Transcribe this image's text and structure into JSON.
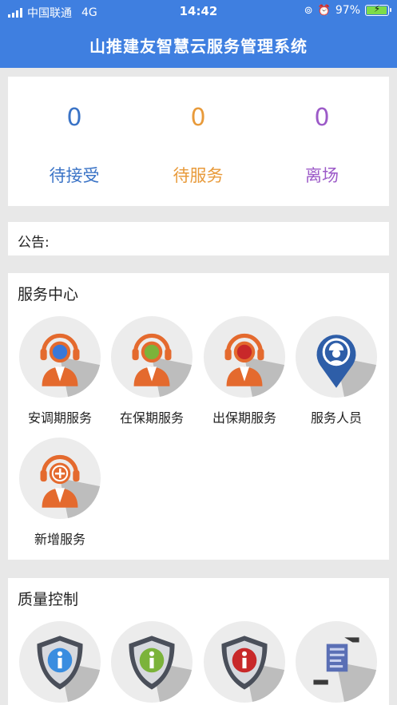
{
  "status_bar": {
    "carrier": "中国联通",
    "network": "4G",
    "time": "14:42",
    "battery": "97%",
    "battery_level": 0.97
  },
  "header": {
    "title": "山推建友智慧云服务管理系统"
  },
  "stats": [
    {
      "value": "0",
      "label": "待接受",
      "color": "#3a73c6"
    },
    {
      "value": "0",
      "label": "待服务",
      "color": "#e89a3a"
    },
    {
      "value": "0",
      "label": "离场",
      "color": "#9c5ac8"
    }
  ],
  "notice": {
    "label": "公告:"
  },
  "service_center": {
    "title": "服务中心",
    "items": [
      {
        "label": "安调期服务",
        "icon": "operator-blue-icon",
        "accent": "#3a78d8"
      },
      {
        "label": "在保期服务",
        "icon": "operator-green-icon",
        "accent": "#7bb33a"
      },
      {
        "label": "出保期服务",
        "icon": "operator-red-icon",
        "accent": "#c8282a"
      },
      {
        "label": "服务人员",
        "icon": "engineer-pin-icon",
        "accent": "#2e5ea8"
      },
      {
        "label": "新增服务",
        "icon": "operator-add-icon",
        "accent": "#e46a2e"
      }
    ]
  },
  "quality_control": {
    "title": "质量控制",
    "items": [
      {
        "icon": "shield-blue-info-icon",
        "accent": "#3a8de0"
      },
      {
        "icon": "shield-green-info-icon",
        "accent": "#7bb33a"
      },
      {
        "icon": "shield-red-info-icon",
        "accent": "#c8282a"
      },
      {
        "icon": "document-hands-icon",
        "accent": "#5a6fb5"
      }
    ]
  }
}
